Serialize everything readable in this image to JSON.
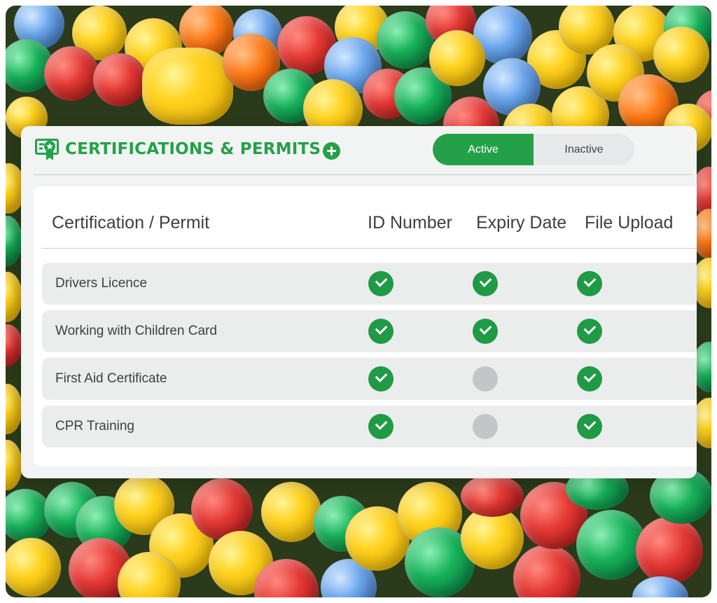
{
  "header": {
    "title": "CERTIFICATIONS & PERMITS",
    "badge_icon": "certificate-badge-icon",
    "add_icon": "plus-circle-icon",
    "toggle": {
      "active_label": "Active",
      "inactive_label": "Inactive",
      "selected": "Active"
    }
  },
  "table": {
    "columns": [
      "Certification / Permit",
      "ID Number",
      "Expiry Date",
      "File Upload"
    ],
    "rows": [
      {
        "name": "Drivers Licence",
        "id_number": "complete",
        "expiry_date": "complete",
        "file_upload": "complete"
      },
      {
        "name": "Working with Children Card",
        "id_number": "complete",
        "expiry_date": "complete",
        "file_upload": "complete"
      },
      {
        "name": "First Aid Certificate",
        "id_number": "complete",
        "expiry_date": "missing",
        "file_upload": "complete"
      },
      {
        "name": "CPR Training",
        "id_number": "complete",
        "expiry_date": "missing",
        "file_upload": "complete"
      }
    ]
  },
  "colors": {
    "accent": "#24a148",
    "status_complete": "#1f9a45",
    "status_missing": "#c3c5c6"
  }
}
